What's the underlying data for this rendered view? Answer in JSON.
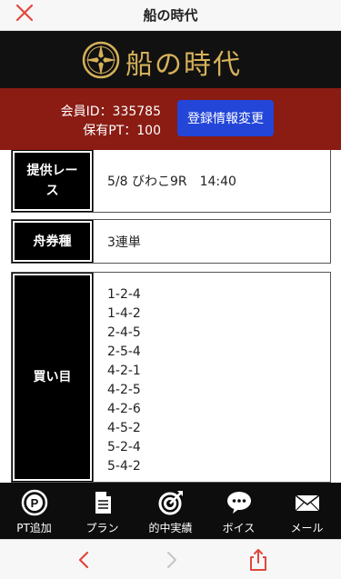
{
  "window": {
    "title": "船の時代"
  },
  "brand": {
    "name": "船の時代"
  },
  "member": {
    "id_text": "会員ID：335785",
    "pt_text": "保有PT：100",
    "edit_button": "登録情報変更"
  },
  "rows": {
    "race": {
      "label": "提供レース",
      "value": "5/8 びわこ9R　14:40"
    },
    "ticket": {
      "label": "舟券種",
      "value": "3連単"
    },
    "buy": {
      "label": "買い目",
      "values": [
        "1-2-4",
        "1-4-2",
        "2-4-5",
        "2-5-4",
        "4-2-1",
        "4-2-5",
        "4-2-6",
        "4-5-2",
        "5-2-4",
        "5-4-2"
      ]
    }
  },
  "nav": {
    "items": [
      {
        "label": "PT追加",
        "icon": "pt-coin-icon"
      },
      {
        "label": "プラン",
        "icon": "document-icon"
      },
      {
        "label": "的中実績",
        "icon": "target-icon"
      },
      {
        "label": "ボイス",
        "icon": "chat-icon"
      },
      {
        "label": "メール",
        "icon": "mail-icon"
      }
    ]
  },
  "colors": {
    "brand_gold": "#d6b15a",
    "member_band": "#8a1c14",
    "button_blue": "#2446d8",
    "close_red": "#e0473d"
  }
}
